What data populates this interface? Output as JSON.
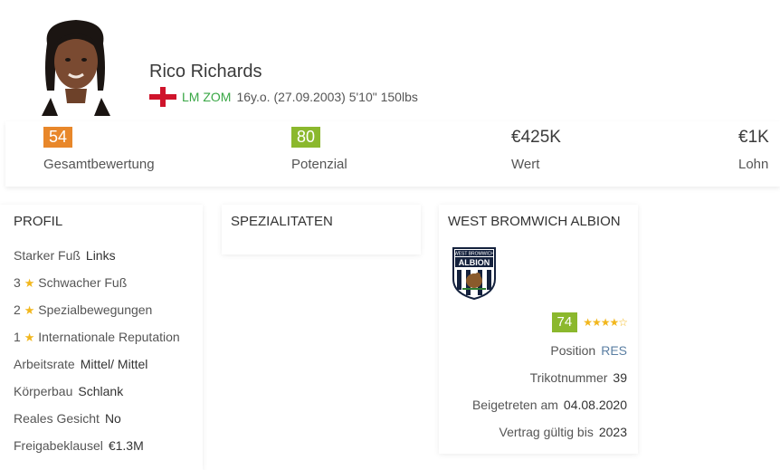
{
  "player": {
    "name": "Rico Richards",
    "positions": "LM ZOM",
    "details": "16y.o. (27.09.2003) 5'10\" 150lbs",
    "flag_icon": "england-flag-icon",
    "accent_color": "#39a745"
  },
  "stats": [
    {
      "value": "54",
      "label": "Gesamtbewertung",
      "badge_color": "#e8872a"
    },
    {
      "value": "80",
      "label": "Potenzial",
      "badge_color": "#8bb82d"
    },
    {
      "value": "€425K",
      "label": "Wert"
    },
    {
      "value": "€1K",
      "label": "Lohn"
    }
  ],
  "profil": {
    "title": "PROFIL",
    "rows": [
      {
        "label": "Starker Fuß",
        "value": "Links"
      },
      {
        "num": "3",
        "label": "Schwacher Fuß"
      },
      {
        "num": "2",
        "label": "Spezialbewegungen"
      },
      {
        "num": "1",
        "label": "Internationale Reputation"
      },
      {
        "label": "Arbeitsrate",
        "value": "Mittel/ Mittel"
      },
      {
        "label": "Körperbau",
        "value": "Schlank"
      },
      {
        "label": "Reales Gesicht",
        "value": "No"
      },
      {
        "label": "Freigabeklausel",
        "value": "€1.3M"
      }
    ],
    "star": "★"
  },
  "spezialitaten": {
    "title": "SPEZIALITATEN"
  },
  "club": {
    "title": "WEST BROMWICH ALBION",
    "logo_text_top": "WEST BROMWICH",
    "logo_text_main": "ALBION",
    "rating": "74",
    "stars": "★★★★☆",
    "rows": [
      {
        "label": "Position",
        "value": "RES"
      },
      {
        "label": "Trikotnummer",
        "value": "39"
      },
      {
        "label": "Beigetreten am",
        "value": "04.08.2020"
      },
      {
        "label": "Vertrag gültig bis",
        "value": "2023"
      }
    ]
  }
}
